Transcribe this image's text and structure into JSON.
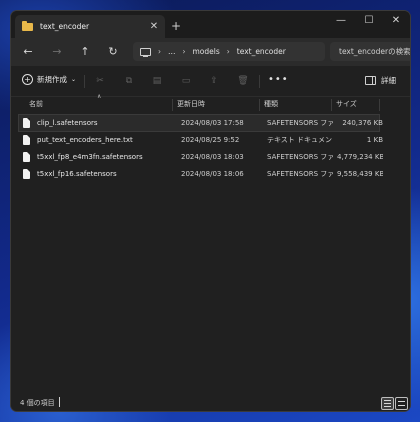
{
  "tab": {
    "title": "text_encoder"
  },
  "breadcrumb": {
    "more": "…",
    "items": [
      "models",
      "text_encoder"
    ]
  },
  "search": {
    "placeholder": "text_encoderの検索"
  },
  "toolbar": {
    "new_label": "新規作成",
    "details_label": "詳細",
    "more_glyph": "•••"
  },
  "columns": {
    "name": "名前",
    "date": "更新日時",
    "type": "種類",
    "size": "サイズ"
  },
  "files": [
    {
      "name": "clip_l.safetensors",
      "date": "2024/08/03 17:58",
      "type": "SAFETENSORS ファ...",
      "size": "240,376 KB"
    },
    {
      "name": "put_text_encoders_here.txt",
      "date": "2024/08/25 9:52",
      "type": "テキスト ドキュメント",
      "size": "1 KB"
    },
    {
      "name": "t5xxl_fp8_e4m3fn.safetensors",
      "date": "2024/08/03 18:03",
      "type": "SAFETENSORS ファ...",
      "size": "4,779,234 KB"
    },
    {
      "name": "t5xxl_fp16.safetensors",
      "date": "2024/08/03 18:06",
      "type": "SAFETENSORS ファ...",
      "size": "9,558,439 KB"
    }
  ],
  "status": {
    "item_count": "4 個の項目"
  },
  "colors": {
    "folder": "#e8b84a",
    "window_bg": "#202020",
    "selected_row": "#2b2b2b"
  },
  "icons": [
    "folder-icon",
    "close-icon",
    "plus-icon",
    "minimize-icon",
    "maximize-icon",
    "back-icon",
    "forward-icon",
    "up-icon",
    "refresh-icon",
    "pc-icon",
    "cut-icon",
    "copy-icon",
    "paste-icon",
    "rename-icon",
    "share-icon",
    "delete-icon",
    "details-icon",
    "file-icon",
    "list-view-icon",
    "tile-view-icon"
  ]
}
